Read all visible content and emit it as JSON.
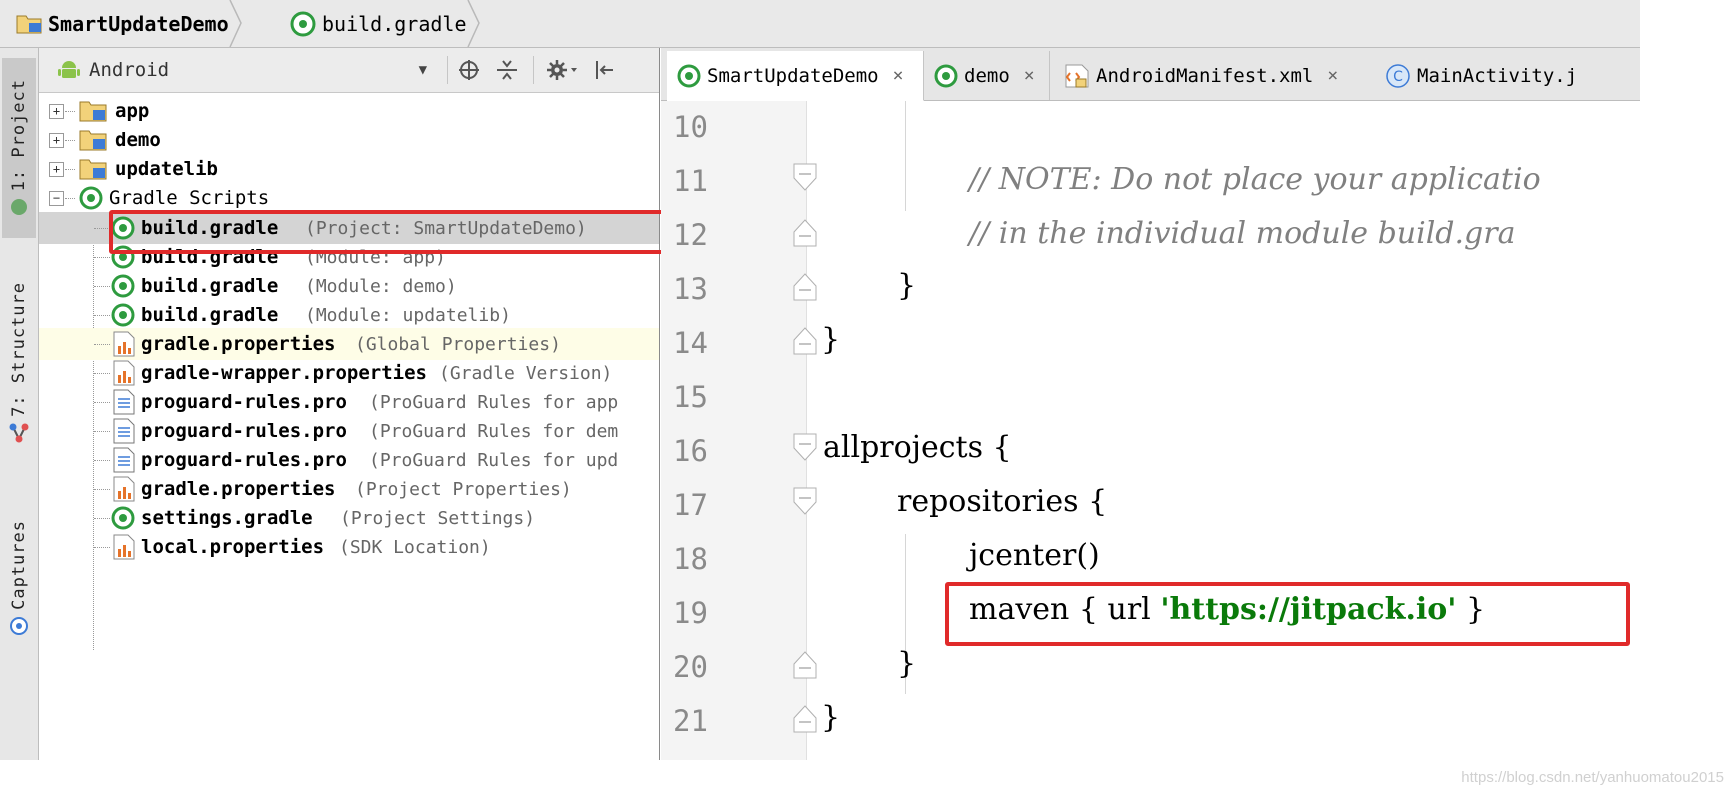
{
  "breadcrumb": {
    "items": [
      {
        "label": "SmartUpdateDemo",
        "icon": "project-folder-icon"
      },
      {
        "label": "build.gradle",
        "icon": "gradle-icon"
      }
    ]
  },
  "tool_strip": {
    "tabs": [
      {
        "label": "1: Project",
        "icon": "project-icon"
      },
      {
        "label": "7: Structure",
        "icon": "structure-icon"
      },
      {
        "label": "Captures",
        "icon": "captures-icon"
      }
    ]
  },
  "project_panel": {
    "view_selector": "Android",
    "toolbar_icons": [
      "locate-icon",
      "collapse-all-icon",
      "settings-gear-icon",
      "hide-panel-icon"
    ],
    "tree": [
      {
        "name": "app",
        "hint": "",
        "type": "module",
        "expanded": false
      },
      {
        "name": "demo",
        "hint": "",
        "type": "module",
        "expanded": false
      },
      {
        "name": "updatelib",
        "hint": "",
        "type": "module",
        "expanded": false
      },
      {
        "name": "Gradle Scripts",
        "hint": "",
        "type": "gradle-group",
        "expanded": true
      },
      {
        "name": "build.gradle",
        "hint": "(Project: SmartUpdateDemo)",
        "type": "gradle",
        "selected": true
      },
      {
        "name": "build.gradle",
        "hint": "(Module: app)",
        "type": "gradle"
      },
      {
        "name": "build.gradle",
        "hint": "(Module: demo)",
        "type": "gradle"
      },
      {
        "name": "build.gradle",
        "hint": "(Module: updatelib)",
        "type": "gradle"
      },
      {
        "name": "gradle.properties",
        "hint": "(Global Properties)",
        "type": "properties"
      },
      {
        "name": "gradle-wrapper.properties",
        "hint": "(Gradle Version)",
        "type": "properties"
      },
      {
        "name": "proguard-rules.pro",
        "hint": "(ProGuard Rules for app",
        "type": "text"
      },
      {
        "name": "proguard-rules.pro",
        "hint": "(ProGuard Rules for dem",
        "type": "text"
      },
      {
        "name": "proguard-rules.pro",
        "hint": "(ProGuard Rules for upd",
        "type": "text"
      },
      {
        "name": "gradle.properties",
        "hint": "(Project Properties)",
        "type": "properties"
      },
      {
        "name": "settings.gradle",
        "hint": "(Project Settings)",
        "type": "gradle"
      },
      {
        "name": "local.properties",
        "hint": "(SDK Location)",
        "type": "properties"
      }
    ]
  },
  "editor": {
    "tabs": [
      {
        "label": "SmartUpdateDemo",
        "close": "×",
        "icon": "gradle-icon",
        "active": true
      },
      {
        "label": "demo",
        "close": "×",
        "icon": "gradle-icon"
      },
      {
        "label": "AndroidManifest.xml",
        "close": "×",
        "icon": "xml-manifest-icon"
      },
      {
        "label": "MainActivity.j",
        "close": "",
        "icon": "class-icon"
      }
    ],
    "lines": [
      {
        "no": "10",
        "code": ""
      },
      {
        "no": "11",
        "code": "// NOTE: Do not place your applicatio"
      },
      {
        "no": "12",
        "code": "// in the individual module build.gra"
      },
      {
        "no": "13",
        "code": "}"
      },
      {
        "no": "14",
        "code": "}"
      },
      {
        "no": "15",
        "code": ""
      },
      {
        "no": "16",
        "code": "allprojects {"
      },
      {
        "no": "17",
        "code": "repositories {"
      },
      {
        "no": "18",
        "code": "jcenter()"
      },
      {
        "no": "19",
        "code_pre": "maven { url ",
        "code_str": "'https://jitpack.io'",
        "code_post": " }"
      },
      {
        "no": "20",
        "code": "}"
      },
      {
        "no": "21",
        "code": "}"
      }
    ]
  },
  "colors": {
    "highlight": "#e02a2a",
    "gradle_green": "#2e9b3f",
    "string_green": "#0a7a0a"
  },
  "watermark": "https://blog.csdn.net/yanhuomatou2015"
}
